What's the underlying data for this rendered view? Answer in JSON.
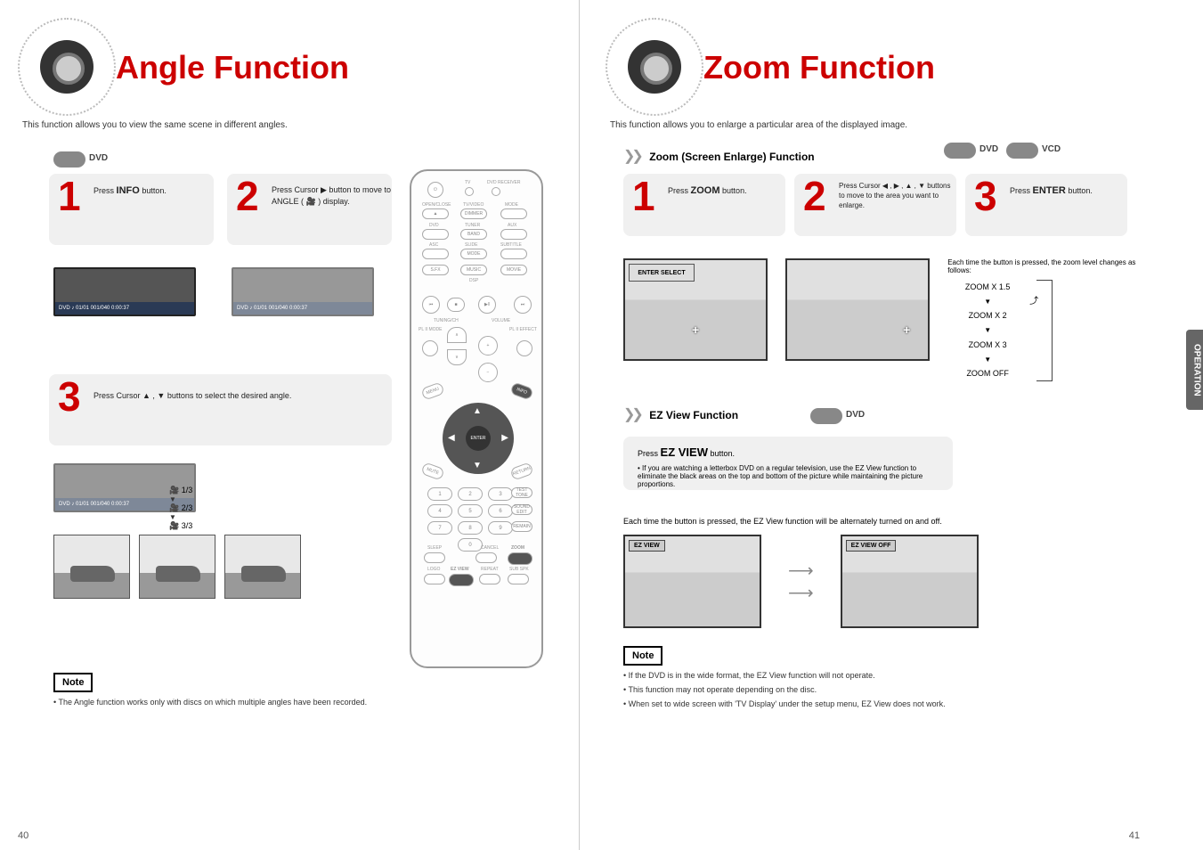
{
  "left": {
    "title": "Angle Function",
    "description": "This function allows you to view the same scene in different angles.",
    "dvd_badge": "DVD",
    "steps": {
      "s1": {
        "num": "1",
        "line1": "Press",
        "bold": "INFO",
        "line2": "button."
      },
      "s2": {
        "num": "2",
        "line1": "Press Cursor ▶ button to move to ANGLE (",
        "line1_end": ") display."
      },
      "s3": {
        "num": "3",
        "line1": "Press Cursor ▲ , ▼ buttons to select the desired angle."
      }
    },
    "osd_bar": "DVD  ♪ 01/01   001/040   0:00:37",
    "angle_opts": [
      "1/3",
      "2/3",
      "3/3"
    ],
    "note_label": "Note",
    "note_text": "• The Angle function works only with discs on which multiple angles have been recorded.",
    "page_num": "40"
  },
  "right": {
    "title": "Zoom Function",
    "description": "This function allows you to enlarge a particular area of the displayed image.",
    "tab_label": "OPERATION",
    "zoom_section_title": "Zoom (Screen Enlarge) Function",
    "dvd_badge": "DVD",
    "vcd_badge": "VCD",
    "steps": {
      "s1": {
        "num": "1",
        "line1": "Press",
        "bold": "ZOOM",
        "line2": "button."
      },
      "s2": {
        "num": "2",
        "line1": "Press Cursor ◀ , ▶ , ▲ , ▼ buttons to move to the area you want to enlarge."
      },
      "s3": {
        "num": "3",
        "line1": "Press",
        "bold": "ENTER",
        "line2": "button."
      }
    },
    "enter_select": "ENTER SELECT",
    "zoom_cycle_note": "Each time the button is pressed, the zoom level changes as follows:",
    "zoom_opts": [
      "ZOOM X 1.5",
      "ZOOM X 2",
      "ZOOM X 3",
      "ZOOM OFF"
    ],
    "ez": {
      "section_title": "EZ View Function",
      "step_line_pre": "Press",
      "step_bold": "EZ VIEW",
      "step_line_post": "button.",
      "toggle_note": "Each time the button is pressed, the EZ View function will be alternately turned on and off.",
      "thumb1_tag": "EZ VIEW",
      "thumb2_tag": "EZ VIEW OFF",
      "sub_note": "• If you are watching a letterbox DVD on a regular television, use the EZ View function to eliminate the black areas on the top and bottom of the picture while maintaining the picture proportions."
    },
    "note_label": "Note",
    "notes": [
      "• If the DVD is in the wide format, the EZ View function will not operate.",
      "• This function may not operate depending on the disc.",
      "• When set to wide screen with 'TV Display' under the setup menu, EZ View does not work."
    ],
    "page_num": "41"
  },
  "remote": {
    "labels": {
      "tv": "TV",
      "dvdrec": "DVD RECEIVER",
      "openclose": "OPEN/CLOSE",
      "tvvideo": "TV/VIDEO",
      "mode": "MODE",
      "dimmer": "DIMMER",
      "dvd": "DVD",
      "tuner": "TUNER",
      "aux": "AUX",
      "band": "BAND",
      "asc": "ASC",
      "slide": "SLIDE",
      "subtitle": "SUBTITLE",
      "mode2": "MODE",
      "sfe": "S.FX",
      "music": "MUSIC",
      "movie": "MOVIE",
      "dsp": "DSP",
      "tuning": "TUNING/CH",
      "volume": "VOLUME",
      "plii_mode": "PL II MODE",
      "plii_effect": "PL II EFFECT",
      "enter": "ENTER",
      "menu": "MENU",
      "info": "INFO",
      "mute": "MUTE",
      "return": "RETURN",
      "testtone": "TEST TONE",
      "soundedit": "SOUND EDIT",
      "remain": "REMAIN",
      "sleep": "SLEEP",
      "cancel": "CANCEL",
      "zoom": "ZOOM",
      "logo": "LOGO",
      "ezview": "EZ VIEW",
      "repeat": "REPEAT",
      "subspk": "SUB SPK"
    }
  }
}
